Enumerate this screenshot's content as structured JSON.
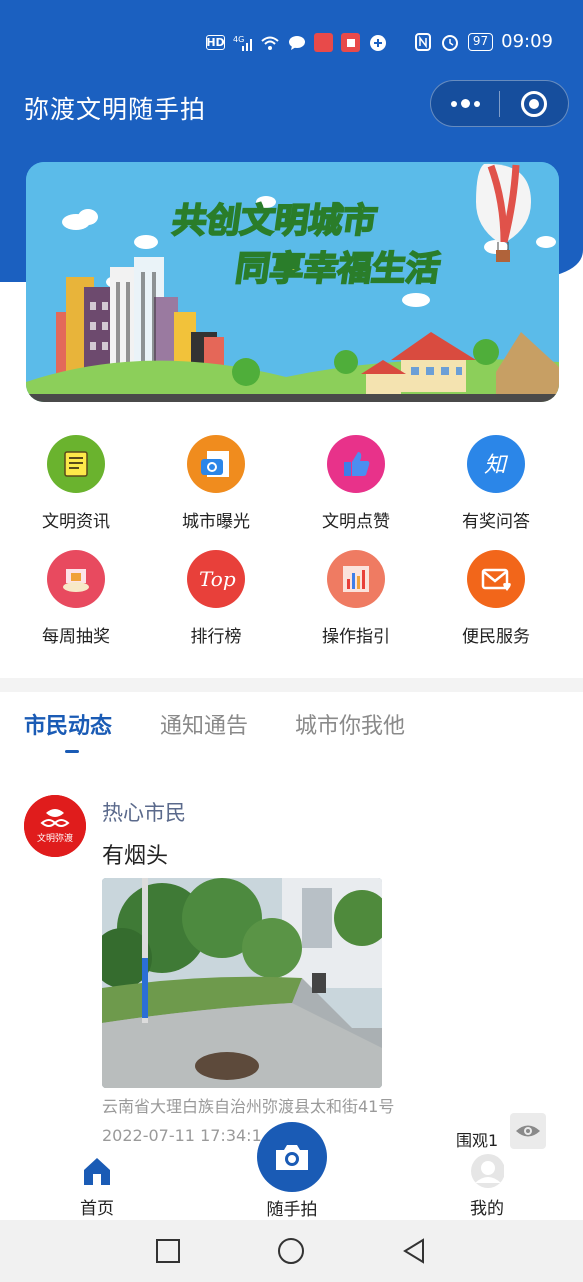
{
  "status_bar": {
    "network_badge": "HD",
    "signal_label": "4G",
    "battery": "97",
    "time": "09:09"
  },
  "app": {
    "title": "弥渡文明随手拍"
  },
  "banner": {
    "line1": "共创文明城市",
    "line2": "同享幸福生活"
  },
  "menu": [
    {
      "label": "文明资讯",
      "icon": "news-icon",
      "color": "#6ab32e"
    },
    {
      "label": "城市曝光",
      "icon": "camera-news-icon",
      "color": "#f08c1e"
    },
    {
      "label": "文明点赞",
      "icon": "thumbs-up-icon",
      "color": "#e8328a"
    },
    {
      "label": "有奖问答",
      "icon": "zhi-icon",
      "color": "#2b86e8"
    },
    {
      "label": "每周抽奖",
      "icon": "gift-icon",
      "color": "#e84a5f"
    },
    {
      "label": "排行榜",
      "icon": "top-icon",
      "color": "#e8403a"
    },
    {
      "label": "操作指引",
      "icon": "bar-chart-icon",
      "color": "#ef7b62"
    },
    {
      "label": "便民服务",
      "icon": "mail-heart-icon",
      "color": "#f2661a"
    }
  ],
  "tabs": [
    {
      "label": "市民动态",
      "active": true
    },
    {
      "label": "通知通告",
      "active": false
    },
    {
      "label": "城市你我他",
      "active": false
    }
  ],
  "post": {
    "user": "热心市民",
    "avatar_text": "文明弥渡",
    "text": "有烟头",
    "address": "云南省大理白族自治州弥渡县太和街41号",
    "time": "2022-07-11 17:34:1",
    "views": "围观1"
  },
  "tabbar": {
    "home": "首页",
    "capture": "随手拍",
    "mine": "我的"
  },
  "colors": {
    "primary": "#1b60c0",
    "tab_active": "#1a5bb5"
  }
}
